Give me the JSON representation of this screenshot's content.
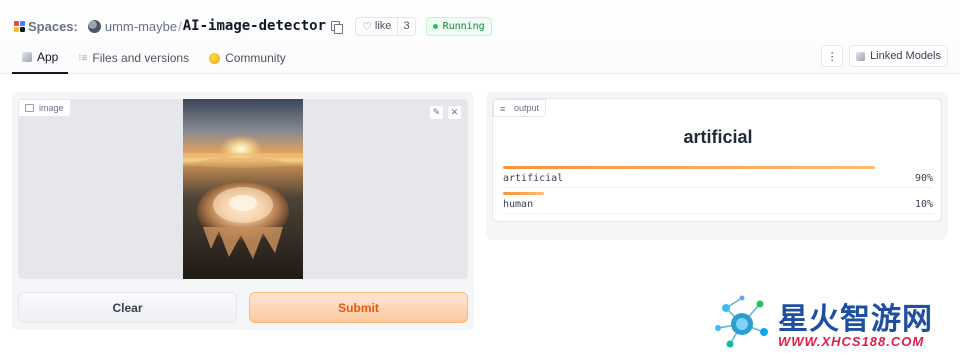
{
  "header": {
    "spaces_label": "Spaces:",
    "owner": "umm-maybe",
    "separator": "/",
    "repo": "AI-image-detector",
    "like_label": "like",
    "like_count": "3",
    "status": "Running",
    "status_color": "#22c55e"
  },
  "tabs": [
    {
      "label": "App",
      "icon": "app-cube-icon"
    },
    {
      "label": "Files and versions",
      "icon": "files-icon"
    },
    {
      "label": "Community",
      "icon": "community-icon"
    }
  ],
  "actions": {
    "more_icon": "⋮",
    "linked_models": "Linked Models"
  },
  "input": {
    "label": "image",
    "edit_icon": "✎",
    "close_icon": "✕"
  },
  "buttons": {
    "clear": "Clear",
    "submit": "Submit"
  },
  "output": {
    "label": "output",
    "prediction": "artificial",
    "confidences": [
      {
        "label": "artificial",
        "value": 0.9,
        "display": "90%"
      },
      {
        "label": "human",
        "value": 0.1,
        "display": "10%"
      }
    ],
    "accent_color": "#fb923c"
  },
  "watermark": {
    "title": "星火智游网",
    "url": "WWW.XHCS188.COM"
  }
}
